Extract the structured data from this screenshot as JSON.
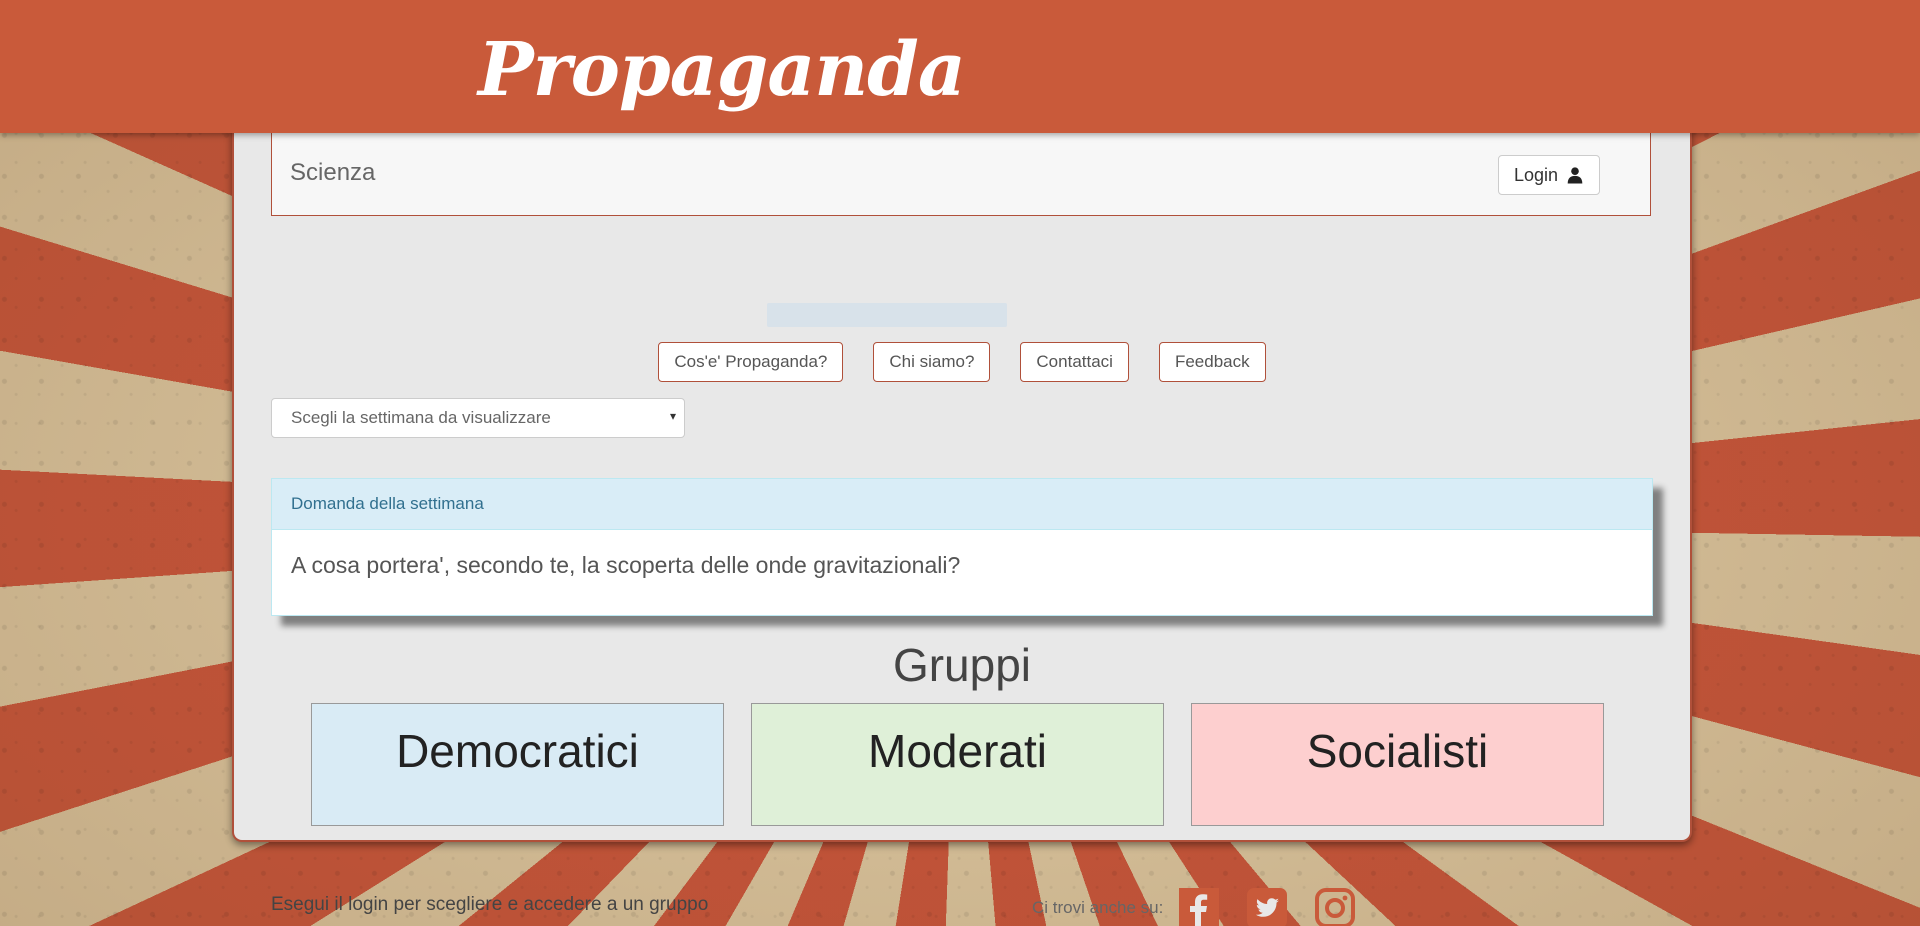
{
  "header": {
    "brand": "Propaganda"
  },
  "subject": {
    "title": "Scienza"
  },
  "login": {
    "label": "Login",
    "icon": "user-icon"
  },
  "nav": [
    {
      "label": "Cos'e' Propaganda?"
    },
    {
      "label": "Chi siamo?"
    },
    {
      "label": "Contattaci"
    },
    {
      "label": "Feedback"
    }
  ],
  "week_select": {
    "value": "Scegli la settimana da visualizzare",
    "caret": "▾"
  },
  "question": {
    "heading": "Domanda della settimana",
    "text": "A cosa portera', secondo te, la scoperta delle onde gravitazionali?"
  },
  "groups": {
    "title": "Gruppi",
    "items": [
      {
        "label": "Democratici",
        "color": "#d9ebf5"
      },
      {
        "label": "Moderati",
        "color": "#dff0d8"
      },
      {
        "label": "Socialisti",
        "color": "#fdcfcf"
      }
    ]
  },
  "footer": {
    "note": "Esegui il login per scegliere e accedere a un gruppo",
    "social_label": "Ci trovi anche su:",
    "social_icons": [
      "facebook-icon",
      "twitter-icon",
      "instagram-icon"
    ]
  },
  "colors": {
    "brand": "#c95a3a",
    "accent_border": "#b0503a",
    "social": "#c95a3a"
  }
}
